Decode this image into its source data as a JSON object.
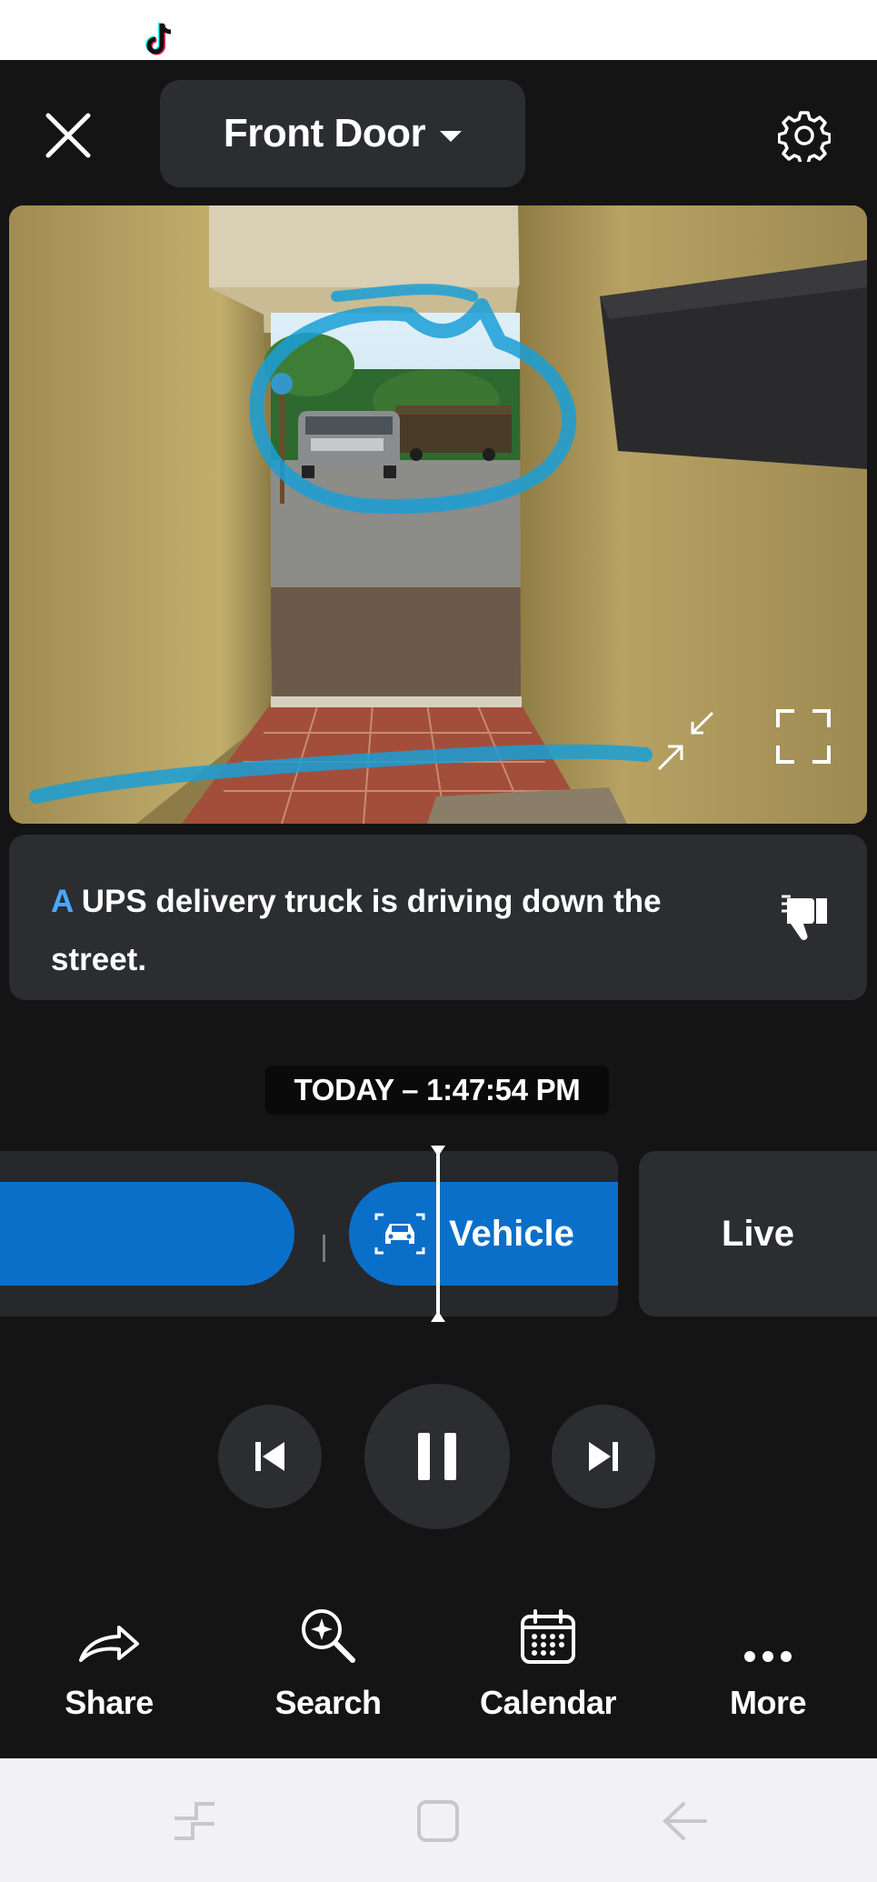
{
  "status_bar": {
    "app_icon": "tiktok-icon"
  },
  "header": {
    "close_icon": "close-icon",
    "camera_name": "Front Door",
    "dropdown_icon": "chevron-down-icon",
    "settings_icon": "gear-icon"
  },
  "video": {
    "controls": [
      "collapse-icon",
      "fullscreen-icon"
    ],
    "annotation_color": "#1a9fd6"
  },
  "caption": {
    "first_letter": "A",
    "text": " UPS delivery truck is driving down the street.",
    "feedback_icon": "thumbs-down-icon"
  },
  "timestamp": "TODAY – 1:47:54 PM",
  "timeline": {
    "events": [
      {
        "label": "",
        "type": "event"
      },
      {
        "label": "Vehicle",
        "type": "vehicle",
        "icon": "car-icon"
      }
    ],
    "live_label": "Live",
    "accent": "#0a6fc9"
  },
  "playback": {
    "prev_icon": "skip-previous-icon",
    "pause_icon": "pause-icon",
    "next_icon": "skip-next-icon"
  },
  "actions": {
    "share": "Share",
    "search": "Search",
    "calendar": "Calendar",
    "more": "More"
  },
  "nav": {
    "icons": [
      "recent-apps-icon",
      "home-icon",
      "back-icon"
    ]
  }
}
